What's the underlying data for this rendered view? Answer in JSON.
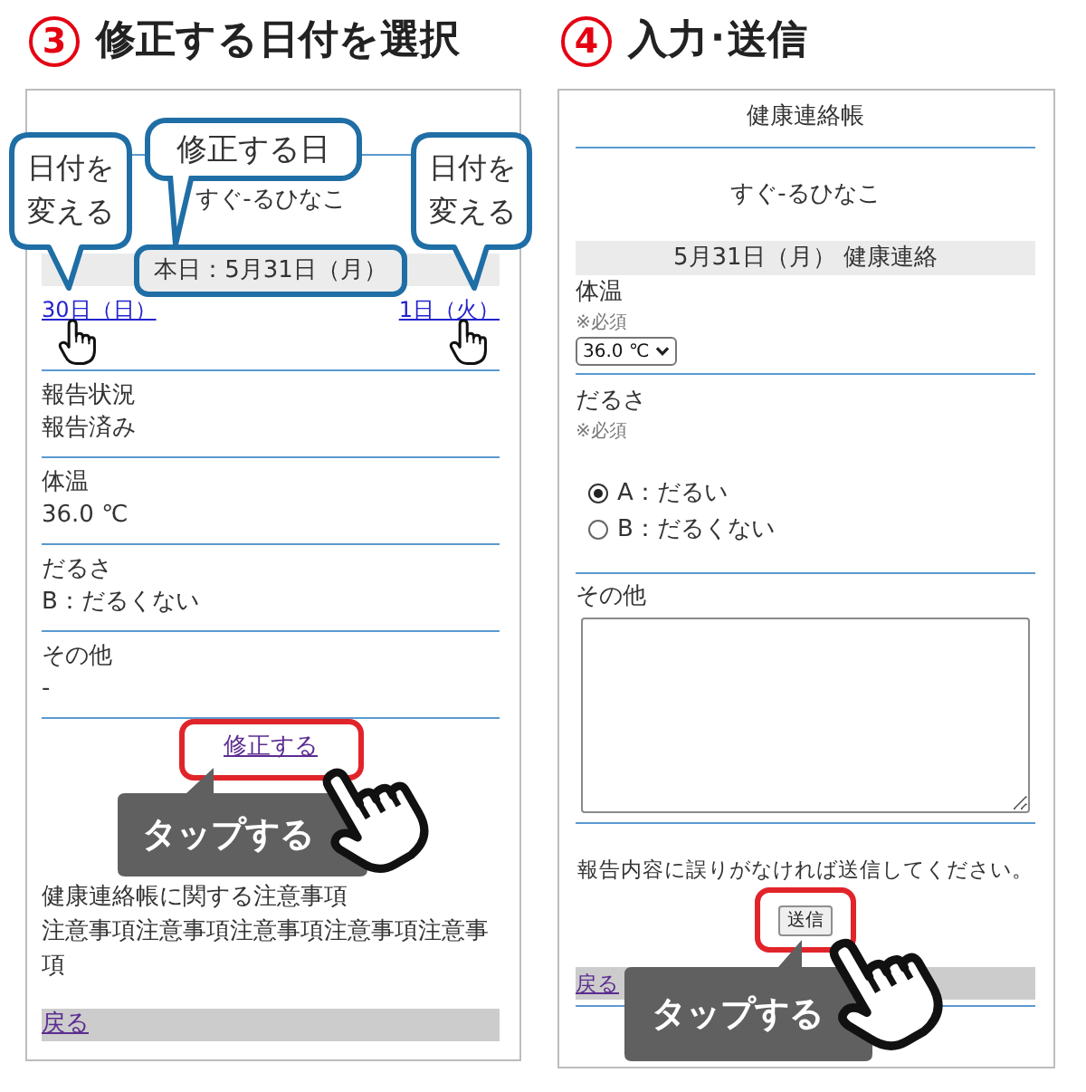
{
  "select_step": {
    "number": "3",
    "heading": "修正する日付を選択",
    "callouts": {
      "left": "日付を変える",
      "center": "修正する日",
      "right": "日付を変える"
    },
    "screen": {
      "child_name": "すぐ-るひなこ",
      "today": "本日：5月31日（月）",
      "prev_day": "30日（日）",
      "next_day": "1日（火）",
      "fields": [
        {
          "label": "報告状況",
          "value": "報告済み"
        },
        {
          "label": "体温",
          "value": "36.0 ℃"
        },
        {
          "label": "だるさ",
          "value": "B：だるくない"
        },
        {
          "label": "その他",
          "value": "-"
        }
      ],
      "edit_link": "修正する",
      "notice_title": "健康連絡帳に関する注意事項",
      "notice_body": "注意事項注意事項注意事項注意事項注意事項",
      "back_link": "戻る"
    },
    "tap_label": "タップする"
  },
  "send_step": {
    "number": "4",
    "heading": "入力･送信",
    "screen": {
      "title": "健康連絡帳",
      "child_name": "すぐ-るひなこ",
      "date_bar": "5月31日（月） 健康連絡",
      "temperature": {
        "label": "体温",
        "required": "※必須",
        "value": "36.0 ℃"
      },
      "fatigue": {
        "label": "だるさ",
        "required": "※必須",
        "options": [
          {
            "label": "A：だるい",
            "selected": true
          },
          {
            "label": "B：だるくない",
            "selected": false
          }
        ]
      },
      "other": {
        "label": "その他"
      },
      "confirm_text": "報告内容に誤りがなければ送信してください。",
      "send_button": "送信",
      "back_link": "戻る"
    },
    "tap_label": "タップする"
  }
}
